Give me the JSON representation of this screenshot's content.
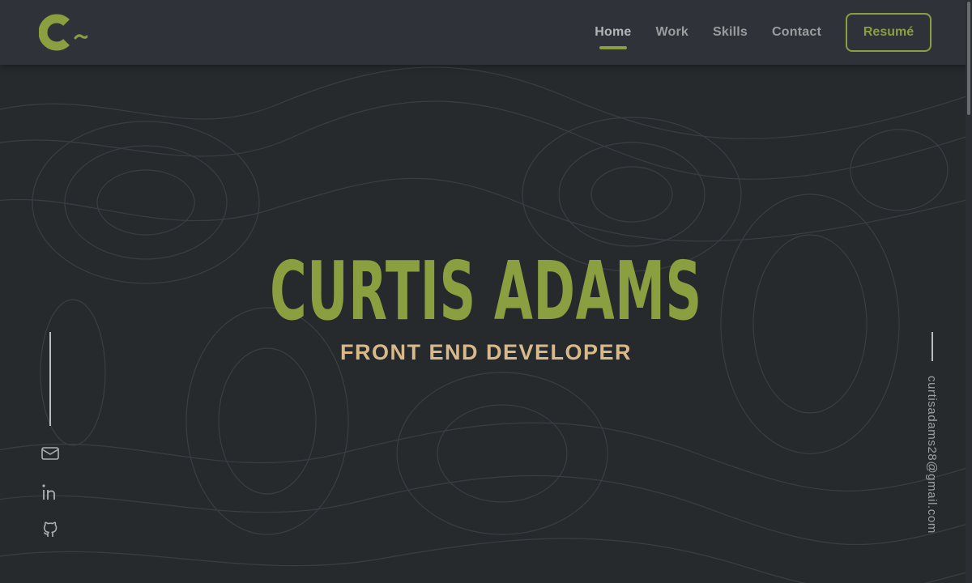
{
  "brand": {
    "logo_icon": "c-logo-icon",
    "accent": "#8a9f3f"
  },
  "nav": {
    "items": [
      {
        "label": "Home",
        "active": true
      },
      {
        "label": "Work",
        "active": false
      },
      {
        "label": "Skills",
        "active": false
      },
      {
        "label": "Contact",
        "active": false
      }
    ],
    "resume_label": "Resumé"
  },
  "hero": {
    "name": "CURTIS ADAMS",
    "title": "FRONT END DEVELOPER",
    "name_color": "#8a9f3f",
    "title_color": "#d7b98a"
  },
  "social": {
    "icons": [
      "mail-icon",
      "linkedin-icon",
      "github-icon"
    ]
  },
  "contact": {
    "email": "curtisadams28@gmail.com"
  },
  "colors": {
    "background": "#272a2d",
    "header": "#2f3339"
  }
}
